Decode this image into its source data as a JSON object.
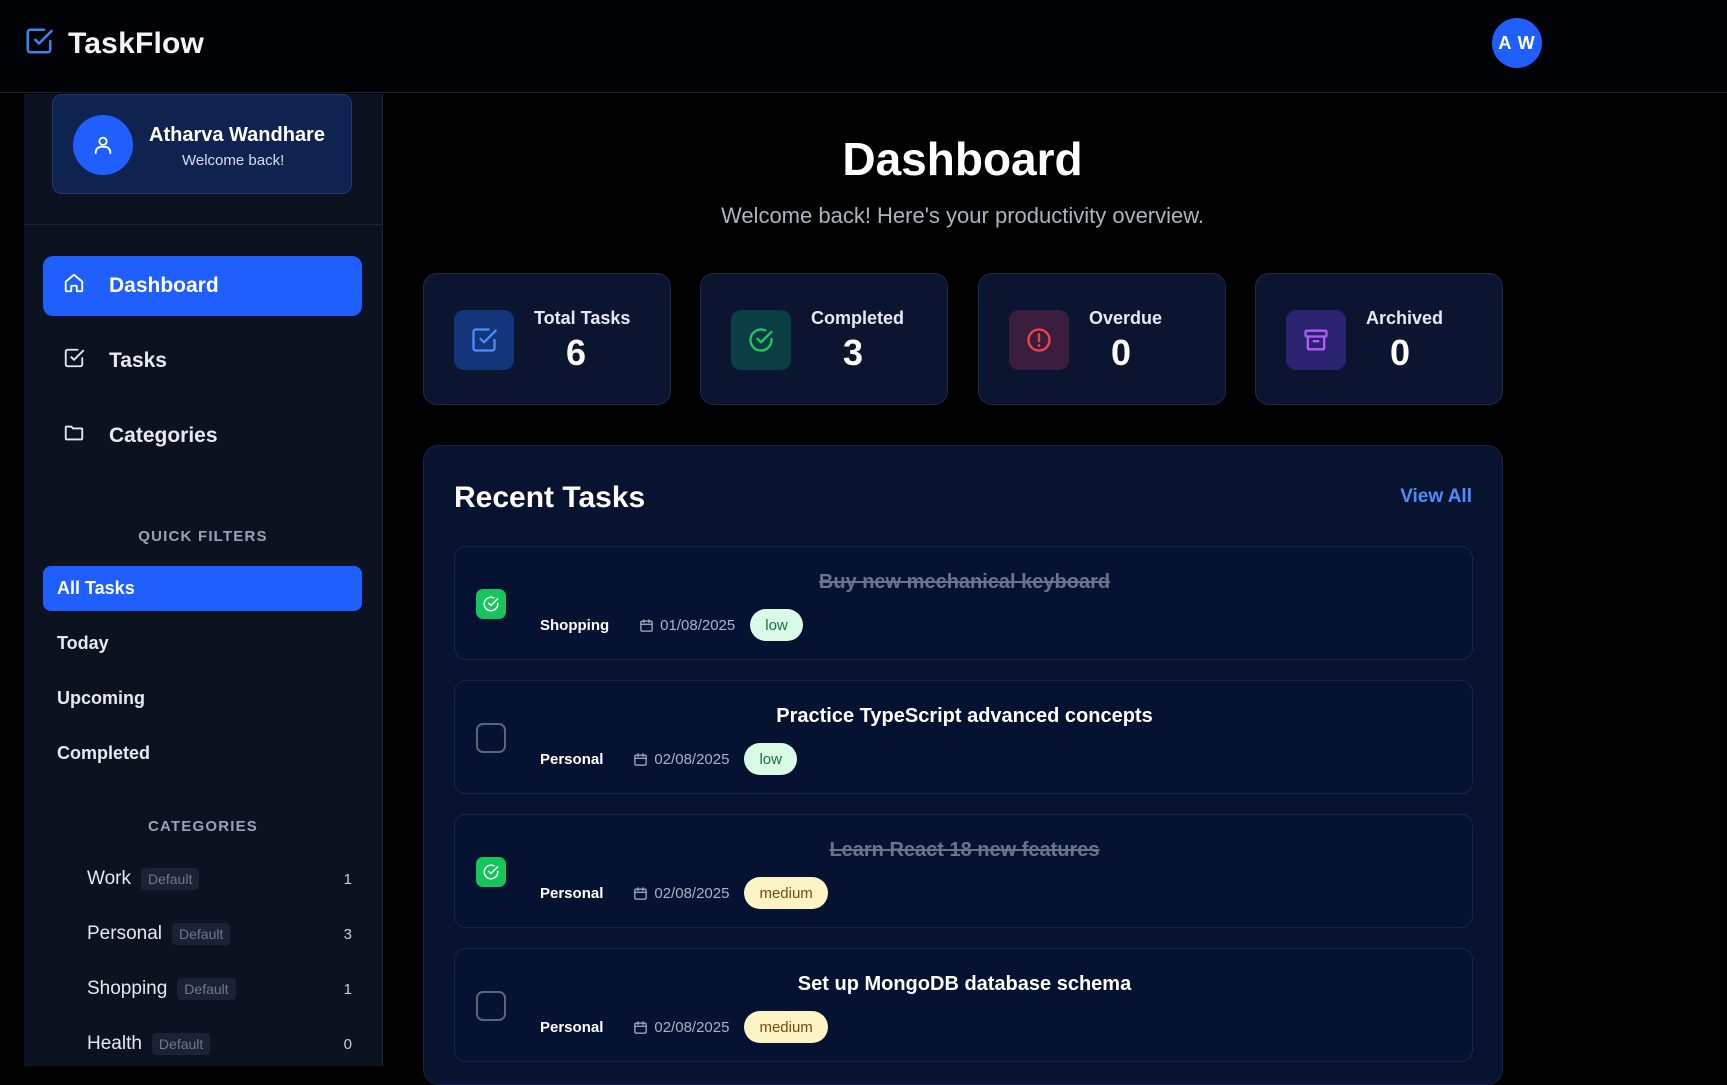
{
  "header": {
    "app_title": "TaskFlow",
    "user_initials": "A W"
  },
  "sidebar": {
    "profile": {
      "name": "Atharva Wandhare",
      "subtitle": "Welcome back!"
    },
    "nav": [
      {
        "label": "Dashboard",
        "icon": "home-icon",
        "active": true
      },
      {
        "label": "Tasks",
        "icon": "checkbox-icon",
        "active": false
      },
      {
        "label": "Categories",
        "icon": "folder-icon",
        "active": false
      }
    ],
    "quick_filters_label": "QUICK FILTERS",
    "filters": [
      {
        "label": "All Tasks",
        "active": true
      },
      {
        "label": "Today",
        "active": false
      },
      {
        "label": "Upcoming",
        "active": false
      },
      {
        "label": "Completed",
        "active": false
      }
    ],
    "categories_label": "CATEGORIES",
    "categories": [
      {
        "name": "Work",
        "tag": "Default",
        "count": "1"
      },
      {
        "name": "Personal",
        "tag": "Default",
        "count": "3"
      },
      {
        "name": "Shopping",
        "tag": "Default",
        "count": "1"
      },
      {
        "name": "Health",
        "tag": "Default",
        "count": "0"
      }
    ]
  },
  "main": {
    "title": "Dashboard",
    "subtitle": "Welcome back! Here's your productivity overview.",
    "stats": [
      {
        "label": "Total Tasks",
        "value": "6",
        "icon": "checkbox-icon",
        "color": "#4c8dff"
      },
      {
        "label": "Completed",
        "value": "3",
        "icon": "check-circle-icon",
        "color": "#22c55e"
      },
      {
        "label": "Overdue",
        "value": "0",
        "icon": "alert-circle-icon",
        "color": "#ef4444"
      },
      {
        "label": "Archived",
        "value": "0",
        "icon": "archive-icon",
        "color": "#a855f7"
      }
    ],
    "recent": {
      "title": "Recent Tasks",
      "view_all": "View All",
      "tasks": [
        {
          "title": "Buy new mechanical keyboard",
          "category": "Shopping",
          "date": "01/08/2025",
          "priority": "low",
          "done": true
        },
        {
          "title": "Practice TypeScript advanced concepts",
          "category": "Personal",
          "date": "02/08/2025",
          "priority": "low",
          "done": false
        },
        {
          "title": "Learn React 18 new features",
          "category": "Personal",
          "date": "02/08/2025",
          "priority": "medium",
          "done": true
        },
        {
          "title": "Set up MongoDB database schema",
          "category": "Personal",
          "date": "02/08/2025",
          "priority": "medium",
          "done": false
        }
      ]
    }
  },
  "colors": {
    "accent": "#1f5fff",
    "background": "#000000",
    "sidebar": "#0d1220",
    "card": "#0b1530",
    "done_green": "#16c55c"
  }
}
